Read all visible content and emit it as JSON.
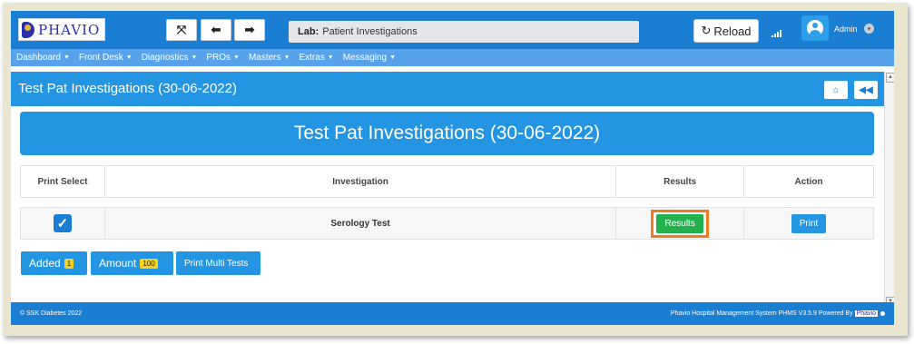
{
  "logo": {
    "text": "PHAVIO"
  },
  "toolbar": {
    "fullscreen_icon": "expand-icon",
    "back_icon": "arrow-left-icon",
    "forward_icon": "arrow-right-icon",
    "lab_prefix": "Lab:",
    "lab_value": "Patient Investigations",
    "reload_label": "Reload",
    "user_name": "Admin"
  },
  "menu": {
    "items": [
      "Dashboard",
      "Front Desk",
      "Diagnostics",
      "PROs",
      "Masters",
      "Extras",
      "Messaging"
    ]
  },
  "page": {
    "header_title": "Test Pat Investigations (30-06-2022)",
    "main_title": "Test Pat Investigations (30-06-2022)"
  },
  "table": {
    "headers": [
      "Print Select",
      "Investigation",
      "Results",
      "Action"
    ],
    "rows": [
      {
        "checked": true,
        "investigation": "Serology Test",
        "results_label": "Results",
        "action_label": "Print"
      }
    ]
  },
  "summary": {
    "added_label": "Added",
    "added_count": "1",
    "amount_label": "Amount",
    "amount_value": "100",
    "print_multi_label": "Print Multi Tests"
  },
  "footer": {
    "left": "© SSK Diabetes 2022",
    "right": "Phavio Hospital Management System PHMS V3.5.9 Powered By",
    "brand": "Phavio"
  },
  "colors": {
    "primary": "#1a7fd3",
    "accent_blue": "#2495e2",
    "success": "#23b14d",
    "highlight": "#f07b1e",
    "badge": "#f6d21f"
  }
}
